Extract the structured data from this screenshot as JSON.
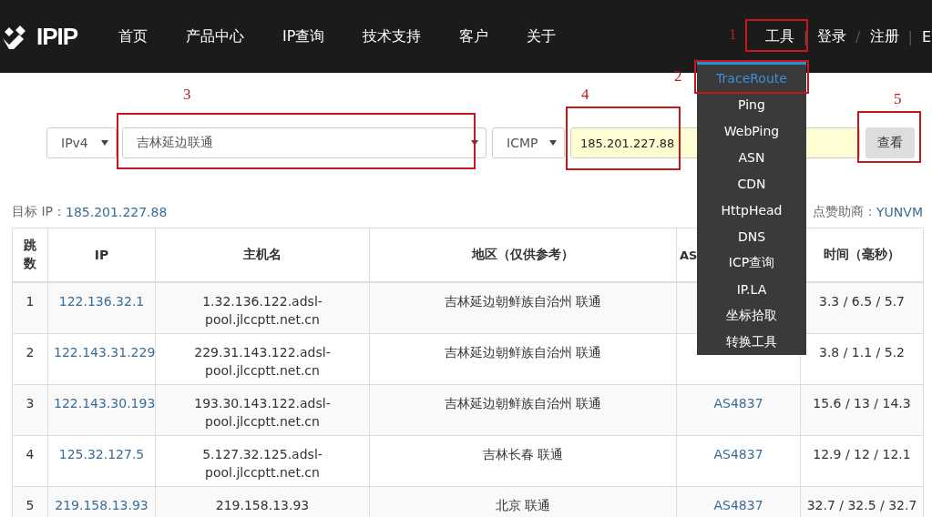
{
  "header": {
    "logo": "IPIP",
    "nav": [
      "首页",
      "产品中心",
      "IP查询",
      "技术支持",
      "客户",
      "关于"
    ],
    "right": [
      {
        "kind": "link",
        "text": "工具"
      },
      {
        "kind": "sep",
        "text": "|"
      },
      {
        "kind": "link",
        "text": "登录"
      },
      {
        "kind": "sep",
        "text": "/"
      },
      {
        "kind": "link",
        "text": "注册"
      },
      {
        "kind": "sep",
        "text": "|"
      },
      {
        "kind": "link",
        "text": "E"
      }
    ]
  },
  "tools_menu": [
    {
      "label": "TraceRoute",
      "selected": true
    },
    {
      "label": "Ping",
      "selected": false
    },
    {
      "label": "WebPing",
      "selected": false
    },
    {
      "label": "ASN",
      "selected": false
    },
    {
      "label": "CDN",
      "selected": false
    },
    {
      "label": "HttpHead",
      "selected": false
    },
    {
      "label": "DNS",
      "selected": false
    },
    {
      "label": "ICP查询",
      "selected": false
    },
    {
      "label": "IP.LA",
      "selected": false
    },
    {
      "label": "坐标拾取",
      "selected": false
    },
    {
      "label": "转换工具",
      "selected": false
    }
  ],
  "form": {
    "ip_version": "IPv4",
    "node": "吉林延边联通",
    "protocol": "ICMP",
    "target": "185.201.227.88",
    "button": "查看"
  },
  "target_label": "目标 IP：",
  "target_ip": "185.201.227.88",
  "sponsor_label": "点赞助商：",
  "sponsor": "YUNVM",
  "table": {
    "columns": [
      "跳数",
      "IP",
      "主机名",
      "地区（仅供参考）",
      "AS",
      "时间（毫秒）"
    ],
    "rows": [
      {
        "hop": "1",
        "ip": "122.136.32.1",
        "host": "1.32.136.122.adsl-pool.jlccptt.net.cn",
        "region": "吉林延边朝鲜族自治州 联通",
        "as": "",
        "time": "3.3 / 6.5 / 5.7"
      },
      {
        "hop": "2",
        "ip": "122.143.31.229",
        "host": "229.31.143.122.adsl-pool.jlccptt.net.cn",
        "region": "吉林延边朝鲜族自治州 联通",
        "as": "",
        "time": "3.8 / 1.1 / 5.2"
      },
      {
        "hop": "3",
        "ip": "122.143.30.193",
        "host": "193.30.143.122.adsl-pool.jlccptt.net.cn",
        "region": "吉林延边朝鲜族自治州 联通",
        "as": "AS4837",
        "time": "15.6 / 13 / 14.3"
      },
      {
        "hop": "4",
        "ip": "125.32.127.5",
        "host": "5.127.32.125.adsl-pool.jlccptt.net.cn",
        "region": "吉林长春 联通",
        "as": "AS4837",
        "time": "12.9 / 12 / 12.1"
      },
      {
        "hop": "5",
        "ip": "219.158.13.93",
        "host": "219.158.13.93",
        "region": "北京 联通",
        "as": "AS4837",
        "time": "32.7 / 32.5 / 32.7"
      }
    ]
  },
  "annotations": [
    "1",
    "2",
    "3",
    "4",
    "5"
  ]
}
